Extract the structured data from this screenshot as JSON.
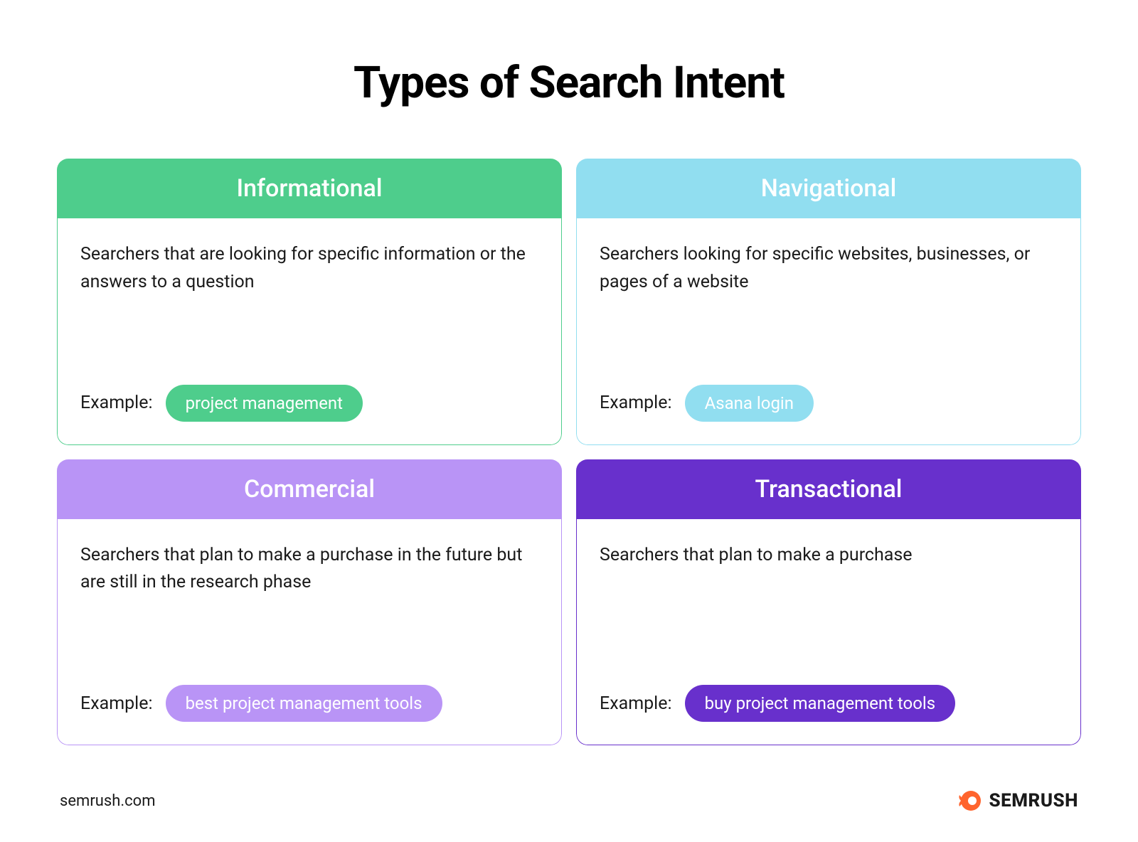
{
  "title": "Types of Search Intent",
  "cards": [
    {
      "header": "Informational",
      "description": "Searchers that are looking for specific information or the answers to a question",
      "exampleLabel": "Example:",
      "examplePill": "project management"
    },
    {
      "header": "Navigational",
      "description": "Searchers looking for specific websites, businesses, or pages of a website",
      "exampleLabel": "Example:",
      "examplePill": "Asana login"
    },
    {
      "header": "Commercial",
      "description": "Searchers that plan to make a purchase in the future but are still in the research phase",
      "exampleLabel": "Example:",
      "examplePill": "best project management tools"
    },
    {
      "header": "Transactional",
      "description": "Searchers that plan to make a purchase",
      "exampleLabel": "Example:",
      "examplePill": "buy project management tools"
    }
  ],
  "footer": {
    "url": "semrush.com",
    "brand": "SEMRUSH"
  },
  "colors": {
    "informational": "#4ECD8C",
    "navigational": "#91DEF0",
    "commercial": "#B994F6",
    "transactional": "#6830CC",
    "logoAccent": "#FF642D"
  }
}
